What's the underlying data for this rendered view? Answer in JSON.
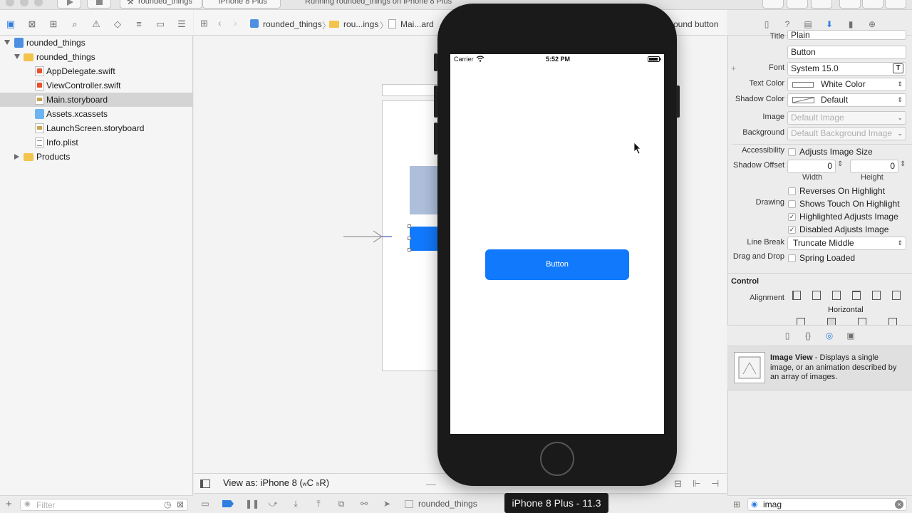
{
  "toolbar": {
    "scheme": "rounded_things",
    "destination": "iPhone 8 Plus",
    "activity": "Running rounded_things on iPhone 8 Plus"
  },
  "navigator": {
    "tree": [
      {
        "label": "rounded_things",
        "type": "project",
        "expanded": true
      },
      {
        "label": "rounded_things",
        "type": "folder",
        "expanded": true
      },
      {
        "label": "AppDelegate.swift",
        "type": "swift"
      },
      {
        "label": "ViewController.swift",
        "type": "swift"
      },
      {
        "label": "Main.storyboard",
        "type": "storyboard",
        "selected": true
      },
      {
        "label": "Assets.xcassets",
        "type": "assets"
      },
      {
        "label": "LaunchScreen.storyboard",
        "type": "storyboard"
      },
      {
        "label": "Info.plist",
        "type": "plist"
      },
      {
        "label": "Products",
        "type": "folder",
        "expanded": false
      }
    ],
    "filter_placeholder": "Filter"
  },
  "jumpbar": {
    "crumbs": [
      "rounded_things",
      "rou...ings",
      "Mai...ard"
    ],
    "trailing": "ound button"
  },
  "canvas": {
    "view_as": "View as: iPhone 8 (",
    "size_class_w": "w",
    "size_class_c": "C",
    "size_class_h": "h",
    "size_class_r": "R)"
  },
  "debug": {
    "target": "rounded_things"
  },
  "simulator": {
    "carrier": "Carrier",
    "time": "5:52 PM",
    "button_label": "Button",
    "device_label": "iPhone 8 Plus - 11.3"
  },
  "inspector": {
    "title_label": "Title",
    "title_type": "Plain",
    "title_value": "Button",
    "font_label": "Font",
    "font_value": "System 15.0",
    "text_color_label": "Text Color",
    "text_color_value": "White Color",
    "shadow_color_label": "Shadow Color",
    "shadow_color_value": "Default",
    "image_label": "Image",
    "image_placeholder": "Default Image",
    "background_label": "Background",
    "background_placeholder": "Default Background Image",
    "accessibility_label": "Accessibility",
    "adjusts_image_size": "Adjusts Image Size",
    "shadow_offset_label": "Shadow Offset",
    "shadow_offset_width": "0",
    "shadow_offset_height": "0",
    "width_label": "Width",
    "height_label": "Height",
    "drawing_label": "Drawing",
    "reverses_on_highlight": "Reverses On Highlight",
    "shows_touch_on_highlight": "Shows Touch On Highlight",
    "highlighted_adjusts_image": "Highlighted Adjusts Image",
    "disabled_adjusts_image": "Disabled Adjusts Image",
    "line_break_label": "Line Break",
    "line_break_value": "Truncate Middle",
    "drag_drop_label": "Drag and Drop",
    "spring_loaded": "Spring Loaded",
    "control_header": "Control",
    "alignment_label": "Alignment",
    "horizontal_label": "Horizontal"
  },
  "library": {
    "item_title": "Image View",
    "item_desc_1": " - Displays a single",
    "item_desc_2": "image, or an animation described by",
    "item_desc_3": "an array of images.",
    "search_value": "imag"
  },
  "colors": {
    "accent_blue": "#1179fb",
    "selection": "#d4d4d4",
    "device_body": "#1a1a1a"
  }
}
